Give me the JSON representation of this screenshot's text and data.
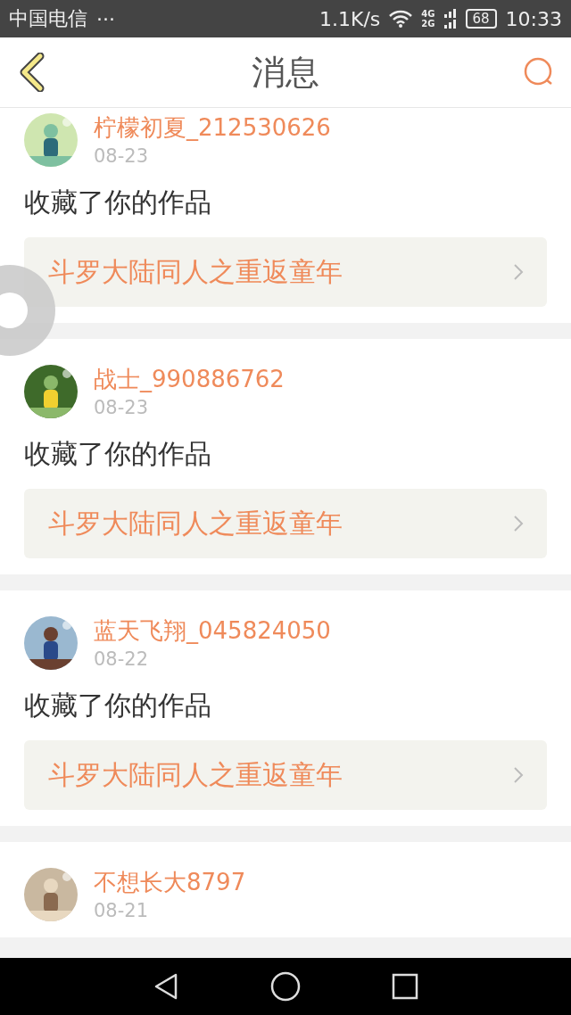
{
  "status_bar": {
    "carrier": "中国电信",
    "more": "···",
    "speed": "1.1K/s",
    "network_top": "4G",
    "network_bottom": "2G",
    "battery": "68",
    "time": "10:33"
  },
  "header": {
    "title": "消息"
  },
  "messages": [
    {
      "user": "柠檬初夏_212530626",
      "date": "08-23",
      "action": "收藏了你的作品",
      "work": "斗罗大陆同人之重返童年"
    },
    {
      "user": "战士_990886762",
      "date": "08-23",
      "action": "收藏了你的作品",
      "work": "斗罗大陆同人之重返童年"
    },
    {
      "user": "蓝天飞翔_045824050",
      "date": "08-22",
      "action": "收藏了你的作品",
      "work": "斗罗大陆同人之重返童年"
    },
    {
      "user": "不想长大8797",
      "date": "08-21"
    }
  ]
}
